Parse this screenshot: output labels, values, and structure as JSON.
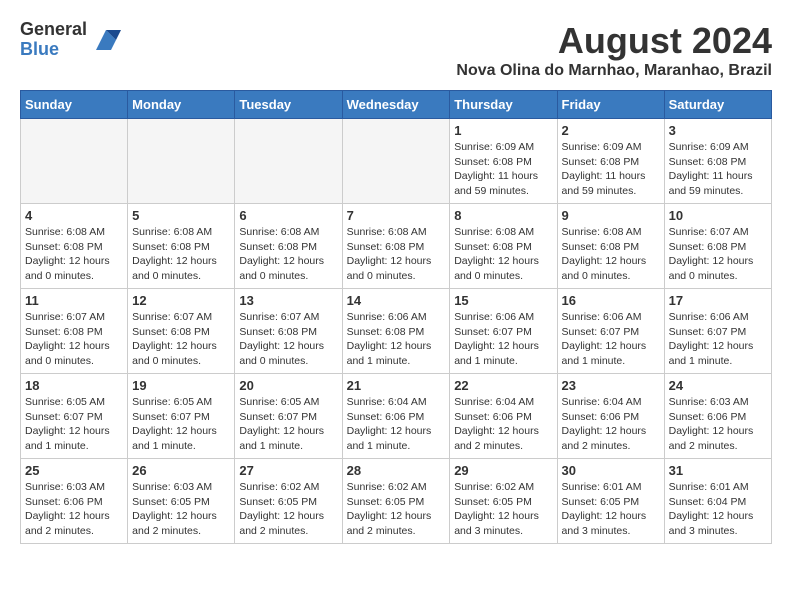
{
  "header": {
    "logo_general": "General",
    "logo_blue": "Blue",
    "month_title": "August 2024",
    "location": "Nova Olina do Marnhao, Maranhao, Brazil"
  },
  "weekdays": [
    "Sunday",
    "Monday",
    "Tuesday",
    "Wednesday",
    "Thursday",
    "Friday",
    "Saturday"
  ],
  "weeks": [
    [
      {
        "day": "",
        "info": ""
      },
      {
        "day": "",
        "info": ""
      },
      {
        "day": "",
        "info": ""
      },
      {
        "day": "",
        "info": ""
      },
      {
        "day": "1",
        "info": "Sunrise: 6:09 AM\nSunset: 6:08 PM\nDaylight: 11 hours and 59 minutes."
      },
      {
        "day": "2",
        "info": "Sunrise: 6:09 AM\nSunset: 6:08 PM\nDaylight: 11 hours and 59 minutes."
      },
      {
        "day": "3",
        "info": "Sunrise: 6:09 AM\nSunset: 6:08 PM\nDaylight: 11 hours and 59 minutes."
      }
    ],
    [
      {
        "day": "4",
        "info": "Sunrise: 6:08 AM\nSunset: 6:08 PM\nDaylight: 12 hours and 0 minutes."
      },
      {
        "day": "5",
        "info": "Sunrise: 6:08 AM\nSunset: 6:08 PM\nDaylight: 12 hours and 0 minutes."
      },
      {
        "day": "6",
        "info": "Sunrise: 6:08 AM\nSunset: 6:08 PM\nDaylight: 12 hours and 0 minutes."
      },
      {
        "day": "7",
        "info": "Sunrise: 6:08 AM\nSunset: 6:08 PM\nDaylight: 12 hours and 0 minutes."
      },
      {
        "day": "8",
        "info": "Sunrise: 6:08 AM\nSunset: 6:08 PM\nDaylight: 12 hours and 0 minutes."
      },
      {
        "day": "9",
        "info": "Sunrise: 6:08 AM\nSunset: 6:08 PM\nDaylight: 12 hours and 0 minutes."
      },
      {
        "day": "10",
        "info": "Sunrise: 6:07 AM\nSunset: 6:08 PM\nDaylight: 12 hours and 0 minutes."
      }
    ],
    [
      {
        "day": "11",
        "info": "Sunrise: 6:07 AM\nSunset: 6:08 PM\nDaylight: 12 hours and 0 minutes."
      },
      {
        "day": "12",
        "info": "Sunrise: 6:07 AM\nSunset: 6:08 PM\nDaylight: 12 hours and 0 minutes."
      },
      {
        "day": "13",
        "info": "Sunrise: 6:07 AM\nSunset: 6:08 PM\nDaylight: 12 hours and 0 minutes."
      },
      {
        "day": "14",
        "info": "Sunrise: 6:06 AM\nSunset: 6:08 PM\nDaylight: 12 hours and 1 minute."
      },
      {
        "day": "15",
        "info": "Sunrise: 6:06 AM\nSunset: 6:07 PM\nDaylight: 12 hours and 1 minute."
      },
      {
        "day": "16",
        "info": "Sunrise: 6:06 AM\nSunset: 6:07 PM\nDaylight: 12 hours and 1 minute."
      },
      {
        "day": "17",
        "info": "Sunrise: 6:06 AM\nSunset: 6:07 PM\nDaylight: 12 hours and 1 minute."
      }
    ],
    [
      {
        "day": "18",
        "info": "Sunrise: 6:05 AM\nSunset: 6:07 PM\nDaylight: 12 hours and 1 minute."
      },
      {
        "day": "19",
        "info": "Sunrise: 6:05 AM\nSunset: 6:07 PM\nDaylight: 12 hours and 1 minute."
      },
      {
        "day": "20",
        "info": "Sunrise: 6:05 AM\nSunset: 6:07 PM\nDaylight: 12 hours and 1 minute."
      },
      {
        "day": "21",
        "info": "Sunrise: 6:04 AM\nSunset: 6:06 PM\nDaylight: 12 hours and 1 minute."
      },
      {
        "day": "22",
        "info": "Sunrise: 6:04 AM\nSunset: 6:06 PM\nDaylight: 12 hours and 2 minutes."
      },
      {
        "day": "23",
        "info": "Sunrise: 6:04 AM\nSunset: 6:06 PM\nDaylight: 12 hours and 2 minutes."
      },
      {
        "day": "24",
        "info": "Sunrise: 6:03 AM\nSunset: 6:06 PM\nDaylight: 12 hours and 2 minutes."
      }
    ],
    [
      {
        "day": "25",
        "info": "Sunrise: 6:03 AM\nSunset: 6:06 PM\nDaylight: 12 hours and 2 minutes."
      },
      {
        "day": "26",
        "info": "Sunrise: 6:03 AM\nSunset: 6:05 PM\nDaylight: 12 hours and 2 minutes."
      },
      {
        "day": "27",
        "info": "Sunrise: 6:02 AM\nSunset: 6:05 PM\nDaylight: 12 hours and 2 minutes."
      },
      {
        "day": "28",
        "info": "Sunrise: 6:02 AM\nSunset: 6:05 PM\nDaylight: 12 hours and 2 minutes."
      },
      {
        "day": "29",
        "info": "Sunrise: 6:02 AM\nSunset: 6:05 PM\nDaylight: 12 hours and 3 minutes."
      },
      {
        "day": "30",
        "info": "Sunrise: 6:01 AM\nSunset: 6:05 PM\nDaylight: 12 hours and 3 minutes."
      },
      {
        "day": "31",
        "info": "Sunrise: 6:01 AM\nSunset: 6:04 PM\nDaylight: 12 hours and 3 minutes."
      }
    ]
  ]
}
